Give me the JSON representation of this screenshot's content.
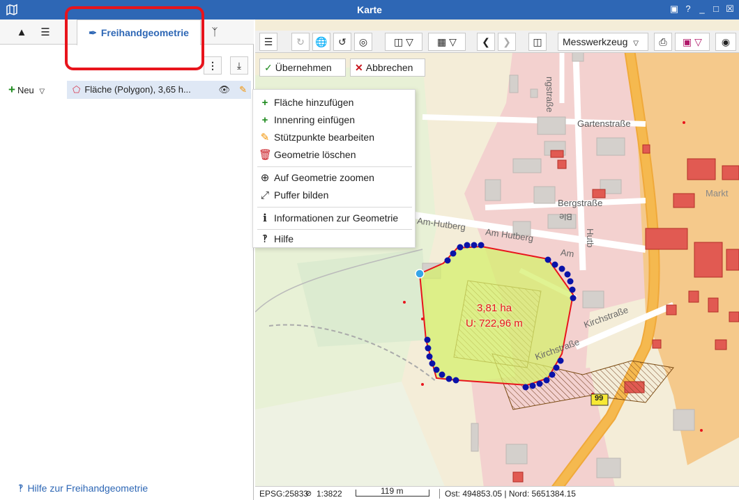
{
  "window": {
    "title": "Karte"
  },
  "left_panel": {
    "active_tab_label": "Freihandgeometrie",
    "new_button_label": "Neu",
    "geometry_item_label": "Fläche (Polygon), 3,65 h...",
    "help_link_label": "Hilfe zur Freihandgeometrie"
  },
  "map_toolbar": {
    "measure_tool_label": "Messwerkzeug"
  },
  "actions": {
    "apply_label": "Übernehmen",
    "cancel_label": "Abbrechen"
  },
  "context_menu": {
    "items": [
      {
        "label": "Fläche hinzufügen",
        "icon": "plus-icon"
      },
      {
        "label": "Innenring einfügen",
        "icon": "plus-icon"
      },
      {
        "label": "Stützpunkte bearbeiten",
        "icon": "pencil-icon"
      },
      {
        "label": "Geometrie löschen",
        "icon": "trash-icon"
      },
      {
        "label": "Auf Geometrie zoomen",
        "icon": "zoom-in-icon"
      },
      {
        "label": "Puffer bilden",
        "icon": "expand-arrows-icon"
      },
      {
        "label": "Informationen zur Geometrie",
        "icon": "info-icon"
      },
      {
        "label": "Hilfe",
        "icon": "question-icon"
      }
    ]
  },
  "map": {
    "polygon_area": "3,81 ha",
    "polygon_perimeter": "U: 722,96 m",
    "street_labels": {
      "gartenstrasse": "Gartenstraße",
      "bergstrasse": "Bergstraße",
      "am_hutberg_1": "Am-Hutberg",
      "am_hutberg_2": "Am Hutberg",
      "am": "Am",
      "kirchstrasse_1": "Kirchstraße",
      "kirchstrasse_2": "Kirchstraße",
      "strasse_top": "ngstraße",
      "markt": "Markt",
      "hutb": "Hutb",
      "ble": "Ble",
      "road_number": "99"
    },
    "colors": {
      "polygon_fill": "#d6ef6e",
      "polygon_stroke": "#e8141c",
      "vertex": "#0a12a8",
      "highlight": "#e8141c",
      "accent": "#2e67b5"
    }
  },
  "status_bar": {
    "epsg": "EPSG:25833",
    "scale": "1:3822",
    "scale_length": "119 m",
    "coordinates": "Ost: 494853.05 | Nord: 5651384.15"
  }
}
